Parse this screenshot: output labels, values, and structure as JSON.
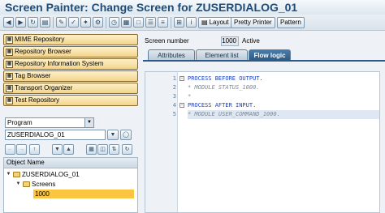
{
  "window": {
    "title": "Screen Painter: Change Screen for ZUSERDIALOG_01"
  },
  "toolbar": {
    "icons": [
      "back-icon",
      "forward-icon",
      "history-icon",
      "refresh-icon",
      "display-change-icon",
      "check-icon",
      "activate-icon",
      "test-icon",
      "where-used-icon",
      "hierarchy-icon",
      "layout-icon",
      "element-list-icon",
      "flow-logic-icon"
    ],
    "layout_label": "Layout",
    "pretty_printer_label": "Pretty Printer",
    "pattern_label": "Pattern"
  },
  "navigator": {
    "buttons": [
      {
        "label": "MIME Repository",
        "icon": "mime-icon"
      },
      {
        "label": "Repository Browser",
        "icon": "browser-icon"
      },
      {
        "label": "Repository Information System",
        "icon": "info-system-icon"
      },
      {
        "label": "Tag Browser",
        "icon": "tag-icon"
      },
      {
        "label": "Transport Organizer",
        "icon": "transport-icon"
      },
      {
        "label": "Test Repository",
        "icon": "test-repo-icon"
      }
    ],
    "object_type": "Program",
    "object_name": "ZUSERDIALOG_01",
    "tree": {
      "header": "Object Name",
      "nodes": [
        {
          "label": "ZUSERDIALOG_01",
          "expanded": true
        },
        {
          "label": "Screens",
          "expanded": true
        },
        {
          "label": "1000",
          "selected": true
        }
      ]
    }
  },
  "screen": {
    "number_label": "Screen number",
    "number_value": "1000",
    "status": "Active"
  },
  "tabs": [
    "Attributes",
    "Element list",
    "Flow logic"
  ],
  "active_tab": "Flow logic",
  "code": [
    {
      "num": "1",
      "text": "PROCESS BEFORE OUTPUT."
    },
    {
      "num": "2",
      "text": "* MODULE STATUS_1000."
    },
    {
      "num": "3",
      "text": "*"
    },
    {
      "num": "4",
      "text": "PROCESS AFTER INPUT."
    },
    {
      "num": "5",
      "text": "* MODULE USER_COMMAND_1000."
    }
  ],
  "colors": {
    "title": "#1f4c78",
    "nav_button": "#f3d58a",
    "active_tab": "#2d5a86",
    "selected_node": "#fbc541",
    "keyword": "#1a3fc4",
    "comment": "#7d8b98"
  }
}
